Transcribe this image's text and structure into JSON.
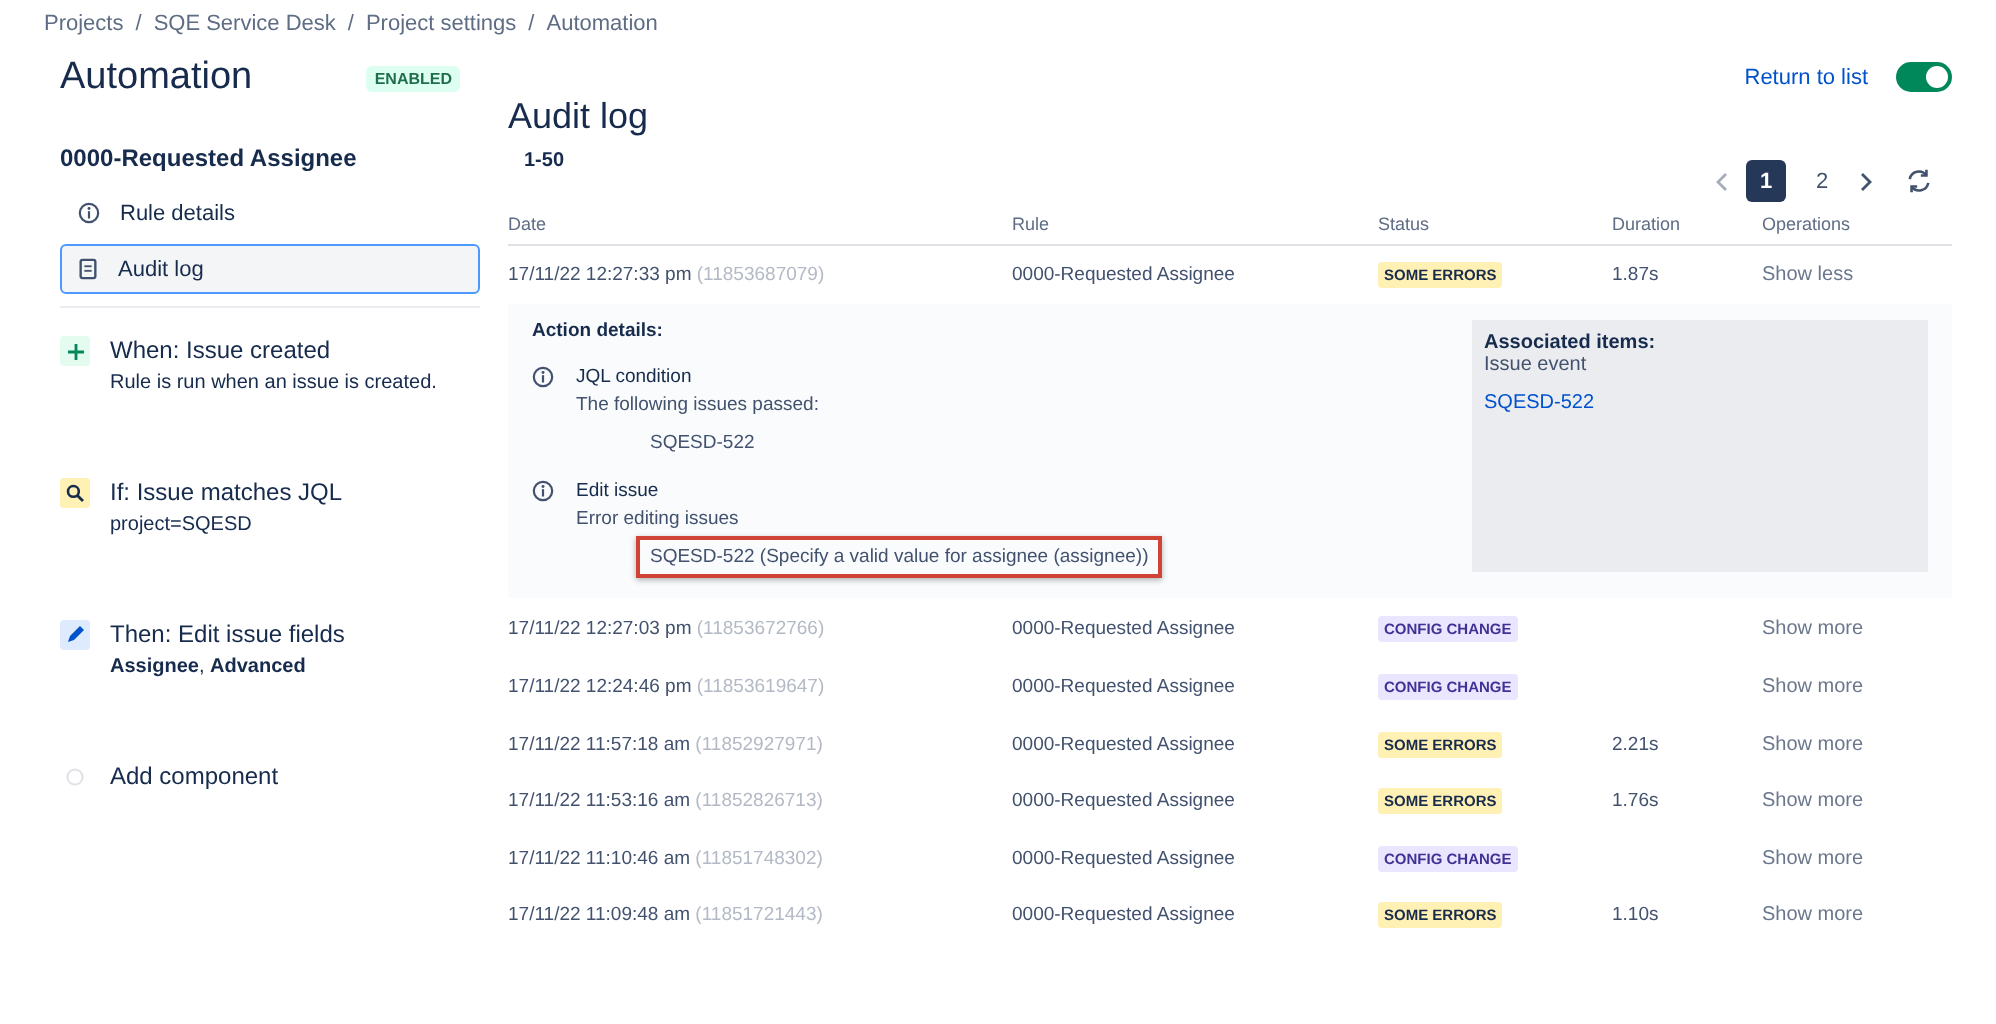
{
  "breadcrumbs": [
    "Projects",
    "SQE Service Desk",
    "Project settings",
    "Automation"
  ],
  "breadcrumb_separator": "/",
  "header": {
    "title": "Automation",
    "badge": "ENABLED",
    "return_link": "Return to list",
    "toggle": {
      "on": true
    }
  },
  "sidebar": {
    "rule_name": "0000-Requested Assignee",
    "nav": [
      {
        "label": "Rule details",
        "kind": "info",
        "selected": false
      },
      {
        "label": "Audit log",
        "kind": "log",
        "selected": true
      }
    ],
    "components": [
      {
        "kind": "trigger",
        "title": "When: Issue created",
        "detail": "Rule is run when an issue is created."
      },
      {
        "kind": "condition",
        "title": "If: Issue matches JQL",
        "detail": "project=SQESD"
      },
      {
        "kind": "action",
        "title": "Then: Edit issue fields",
        "detail": "**Assignee**, **Advanced**"
      },
      {
        "kind": "add",
        "title": "Add component"
      }
    ]
  },
  "audit": {
    "title": "Audit log",
    "range": "1-50",
    "pages": [
      {
        "label": "1",
        "selected": true
      },
      {
        "label": "2",
        "selected": false
      }
    ],
    "columns": [
      "Date",
      "Rule",
      "Status",
      "Duration",
      "Operations"
    ],
    "rows": [
      {
        "date": "17/11/22 12:27:33 pm",
        "id": "(11853687079)",
        "rule": "0000-Requested Assignee",
        "status": "SOME ERRORS",
        "kind": "errors",
        "duration": "1.87s",
        "operation": "Show less",
        "expanded": true
      },
      {
        "date": "17/11/22 12:27:03 pm",
        "id": "(11853672766)",
        "rule": "0000-Requested Assignee",
        "status": "CONFIG CHANGE",
        "kind": "config",
        "operation": "Show more",
        "expanded": false
      },
      {
        "date": "17/11/22 12:24:46 pm",
        "id": "(11853619647)",
        "rule": "0000-Requested Assignee",
        "status": "CONFIG CHANGE",
        "kind": "config",
        "operation": "Show more",
        "expanded": false
      },
      {
        "date": "17/11/22 11:57:18 am",
        "id": "(11852927971)",
        "rule": "0000-Requested Assignee",
        "status": "SOME ERRORS",
        "kind": "errors",
        "duration": "2.21s",
        "operation": "Show more",
        "expanded": false
      },
      {
        "date": "17/11/22 11:53:16 am",
        "id": "(11852826713)",
        "rule": "0000-Requested Assignee",
        "status": "SOME ERRORS",
        "kind": "errors",
        "duration": "1.76s",
        "operation": "Show more",
        "expanded": false
      },
      {
        "date": "17/11/22 11:10:46 am",
        "id": "(11851748302)",
        "rule": "0000-Requested Assignee",
        "status": "CONFIG CHANGE",
        "kind": "config",
        "operation": "Show more",
        "expanded": false
      },
      {
        "date": "17/11/22 11:09:48 am",
        "id": "(11851721443)",
        "rule": "0000-Requested Assignee",
        "status": "SOME ERRORS",
        "kind": "errors",
        "duration": "1.10s",
        "operation": "Show more",
        "expanded": false
      }
    ],
    "details": {
      "heading": "Action details:",
      "actions": [
        {
          "title": "JQL condition",
          "message": "The following issues passed:",
          "item": "SQESD-522",
          "highlighted": false
        },
        {
          "title": "Edit issue",
          "message": "Error editing issues",
          "item": "SQESD-522 (Specify a valid value for assignee (assignee))",
          "highlighted": true
        }
      ],
      "associated": {
        "heading": "Associated items:",
        "label": "Issue event",
        "link": "SQESD-522"
      }
    }
  }
}
